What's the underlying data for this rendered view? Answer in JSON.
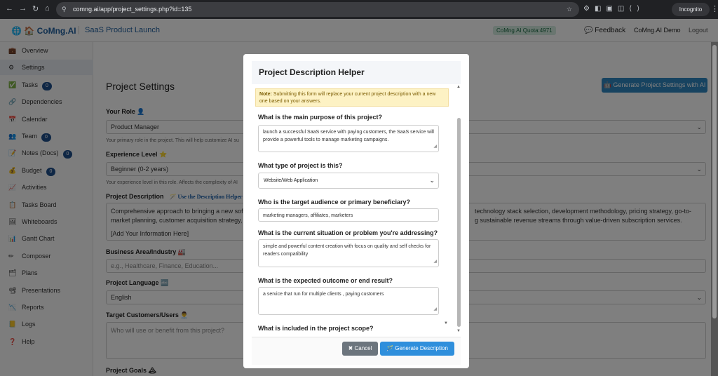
{
  "browser": {
    "url": "comng.ai/app/project_settings.php?id=135",
    "incognito_label": "Incognito"
  },
  "appbar": {
    "brand": "CoMng.AI",
    "project_name": "SaaS Product Launch",
    "quota": "CoMng.AI Quota:4971",
    "feedback": "Feedback",
    "user": "CoMng.AI Demo",
    "logout": "Logout"
  },
  "sidebar": {
    "items": [
      {
        "label": "Overview",
        "icon": "briefcase-icon",
        "glyph": "💼",
        "badge": ""
      },
      {
        "label": "Settings",
        "icon": "gear-icon",
        "glyph": "⚙",
        "badge": ""
      },
      {
        "label": "Tasks",
        "icon": "checkbox-icon",
        "glyph": "✅",
        "badge": "0"
      },
      {
        "label": "Dependencies",
        "icon": "link-icon",
        "glyph": "🔗",
        "badge": ""
      },
      {
        "label": "Calendar",
        "icon": "calendar-icon",
        "glyph": "📅",
        "badge": ""
      },
      {
        "label": "Team",
        "icon": "team-icon",
        "glyph": "👥",
        "badge": "0"
      },
      {
        "label": "Notes (Docs)",
        "icon": "notes-icon",
        "glyph": "📝",
        "badge": "0"
      },
      {
        "label": "Budget",
        "icon": "money-bag-icon",
        "glyph": "💰",
        "badge": "0"
      },
      {
        "label": "Activities",
        "icon": "chart-icon",
        "glyph": "📈",
        "badge": ""
      },
      {
        "label": "Tasks Board",
        "icon": "board-icon",
        "glyph": "📋",
        "badge": ""
      },
      {
        "label": "Whiteboards",
        "icon": "whiteboard-icon",
        "glyph": "🖼",
        "badge": ""
      },
      {
        "label": "Gantt Chart",
        "icon": "gantt-icon",
        "glyph": "📊",
        "badge": ""
      },
      {
        "label": "Composer",
        "icon": "compose-icon",
        "glyph": "✏",
        "badge": ""
      },
      {
        "label": "Plans",
        "icon": "plans-icon",
        "glyph": "🗂",
        "badge": ""
      },
      {
        "label": "Presentations",
        "icon": "presentation-icon",
        "glyph": "📽",
        "badge": ""
      },
      {
        "label": "Reports",
        "icon": "reports-icon",
        "glyph": "📉",
        "badge": ""
      },
      {
        "label": "Logs",
        "icon": "logs-icon",
        "glyph": "📒",
        "badge": ""
      },
      {
        "label": "Help",
        "icon": "question-icon",
        "glyph": "❓",
        "badge": ""
      }
    ]
  },
  "page": {
    "title": "Project Settings",
    "generate_button": "Generate Project Settings with AI",
    "role_label": "Your Role 👤",
    "role_value": "Product Manager",
    "role_help": "Your primary role in the project. This will help customize AI su",
    "experience_label": "Experience Level ⭐",
    "experience_value": "Beginner (0-2 years)",
    "experience_help": "Your experience level in this role. Affects the complexity of AI",
    "description_label": "Project Description",
    "description_helper_link": "🪄 Use the Description Helper",
    "description_line1_left": "Comprehensive approach to bringing a new softw",
    "description_line1_right": "technology stack selection, development methodology, pricing strategy, go-to-",
    "description_line2_left": "market planning, customer acquisition strategy, an",
    "description_line2_right": "g sustainable revenue streams through value-driven subscription services.",
    "description_line3": "[Add Your Information Here]",
    "business_label": "Business Area/Industry 🏭",
    "business_placeholder": "e.g., Healthcare, Finance, Education...",
    "language_label": "Project Language 🔤",
    "language_value": "English",
    "target_label": "Target Customers/Users 👨‍💼",
    "target_placeholder": "Who will use or benefit from this project?",
    "goals_label": "Project Goals 🏔"
  },
  "modal": {
    "title": "Project Description Helper",
    "note_bold": "Note:",
    "note_text": " Submitting this form will replace your current project description with a new one based on your answers.",
    "q1": "What is the main purpose of this project?",
    "a1": "launch a successful SaaS service with paying customers, the SaaS service will provide a powerful tools to manage marketing campaigns.",
    "q2": "What type of project is this?",
    "a2": "Website/Web Application",
    "q3": "Who is the target audience or primary beneficiary?",
    "a3": "marketing managers, affiliates, marketers",
    "q4": "What is the current situation or problem you're addressing?",
    "a4": "simple and powerful content creation with focus on quality and self checks for readers compatibility",
    "q5": "What is the expected outcome or end result?",
    "a5": "a service that run for multiple clients , paying customers",
    "q6": "What is included in the project scope?",
    "cancel": "✖ Cancel",
    "generate": "🪄 Generate Description"
  }
}
